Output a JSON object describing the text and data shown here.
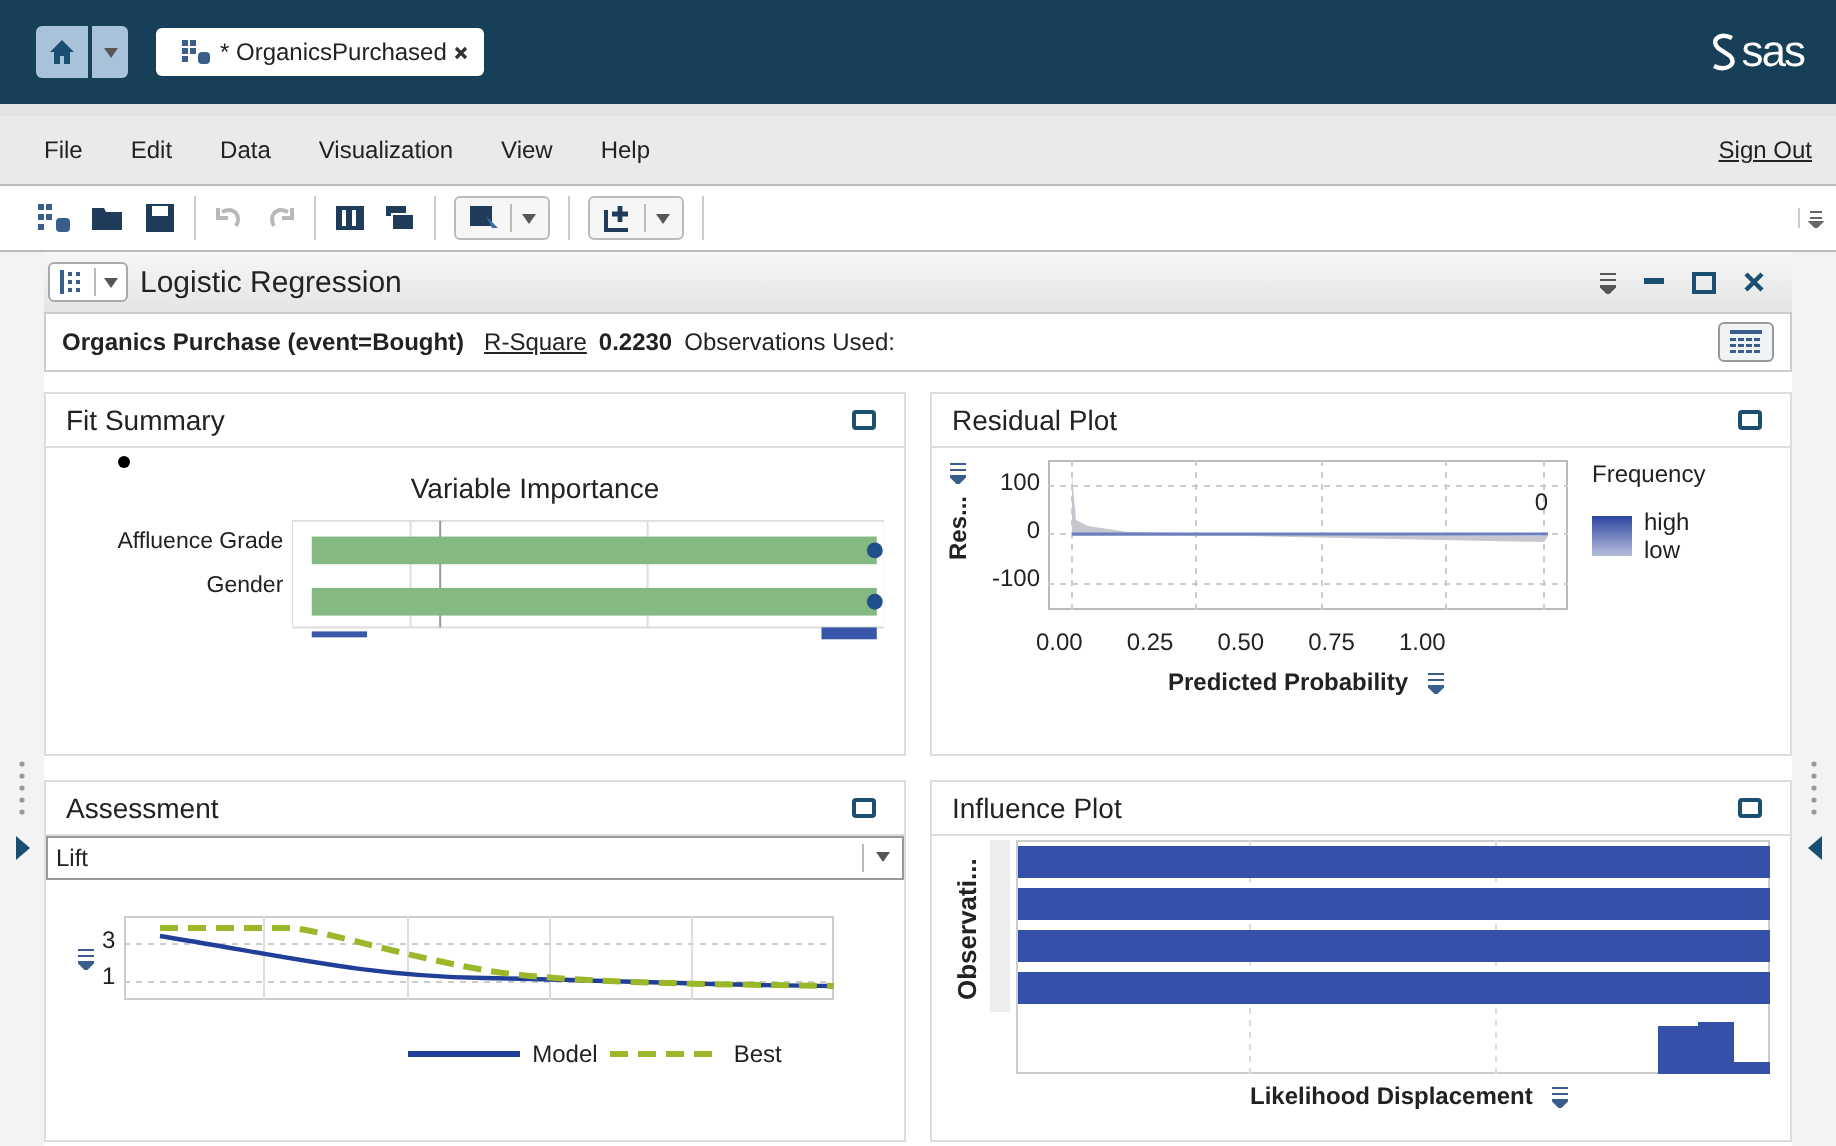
{
  "app_bar": {
    "tabs": [
      {
        "label": "* OrganicsPurchased",
        "selected": true
      }
    ],
    "logo": "sas"
  },
  "menu": {
    "items": [
      "File",
      "Edit",
      "Data",
      "Visualization",
      "View",
      "Help"
    ],
    "sign_out": "Sign Out"
  },
  "object": {
    "title": "Logistic Regression",
    "summary": {
      "response": "Organics Purchase (event=Bought)",
      "r_square_label": "R-Square",
      "r_square": "0.2230",
      "observations_label": "Observations Used:"
    }
  },
  "panels": [
    {
      "kind": "fit_summary",
      "title": "Fit Summary",
      "chart_title": "Variable Importance",
      "labels": [
        "Affluence Grade",
        "Gender"
      ]
    },
    {
      "kind": "residual",
      "title": "Residual Plot",
      "ylabel": "Res...",
      "yticks": [
        "100",
        "0",
        "-100"
      ],
      "xticks": [
        "0.00",
        "0.25",
        "0.50",
        "0.75",
        "1.00"
      ],
      "xlabel": "Predicted Probability",
      "note": "0",
      "legend_title": "Frequency",
      "legend_high": "high",
      "legend_low": "low"
    },
    {
      "kind": "assessment",
      "title": "Assessment",
      "select": "Lift",
      "yticks": [
        "3",
        "1"
      ],
      "legend": [
        {
          "name": "Model",
          "color": "#1f3f99"
        },
        {
          "name": "Best",
          "color": "#9bb82a"
        }
      ]
    },
    {
      "kind": "influence",
      "title": "Influence Plot",
      "ylabel": "Observati...",
      "xlabel": "Likelihood Displacement"
    }
  ]
}
